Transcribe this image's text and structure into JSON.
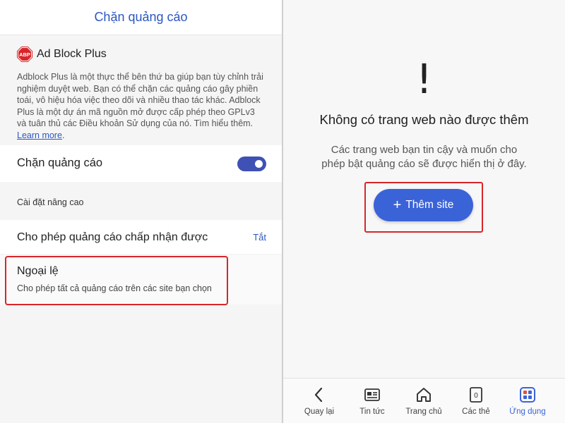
{
  "left_panel": {
    "header_title": "Chặn quảng cáo",
    "extension": {
      "logo_text": "ABP",
      "name": "Ad Block Plus",
      "description": "Adblock Plus là một thực thể bên thứ ba giúp bạn tùy chỉnh trải nghiệm duyệt web. Bạn có thể chặn các quảng cáo gây phiền toái, vô hiệu hóa việc theo dõi và nhiều thao tác khác. Adblock Plus là một dự án mã nguồn mở được cấp phép theo GPLv3 và tuân thủ các Điều khoản Sử dụng của nó. Tìm hiểu thêm.",
      "learn_more": "Learn more"
    },
    "block_ads": {
      "label": "Chặn quảng cáo",
      "enabled": true
    },
    "advanced_section": "Cài đặt nâng cao",
    "allow_acceptable": {
      "label": "Cho phép quảng cáo chấp nhận được",
      "value": "Tắt"
    },
    "exceptions": {
      "label": "Ngoại lệ",
      "sublabel": "Cho phép tất cả quảng cáo trên các site bạn chọn"
    }
  },
  "right_panel": {
    "icon": "!",
    "empty_title": "Không có trang web nào được thêm",
    "empty_desc_line1": "Các trang web bạn tin cậy và muốn cho",
    "empty_desc_line2": "phép bật quảng cáo sẽ được hiển thị ở đây.",
    "add_button": {
      "plus": "+",
      "label": "Thêm site"
    },
    "bottom_nav": [
      {
        "label": "Quay lại",
        "icon": "back-icon"
      },
      {
        "label": "Tin tức",
        "icon": "news-icon"
      },
      {
        "label": "Trang chủ",
        "icon": "home-icon"
      },
      {
        "label": "Các thẻ",
        "icon": "tabs-icon",
        "badge": "0"
      },
      {
        "label": "Ứng dụng",
        "icon": "apps-icon",
        "active": true
      }
    ]
  },
  "colors": {
    "accent": "#3b63d8",
    "toggle_on": "#3f51b5",
    "highlight": "#d9252a",
    "abp_red": "#d9252a"
  }
}
